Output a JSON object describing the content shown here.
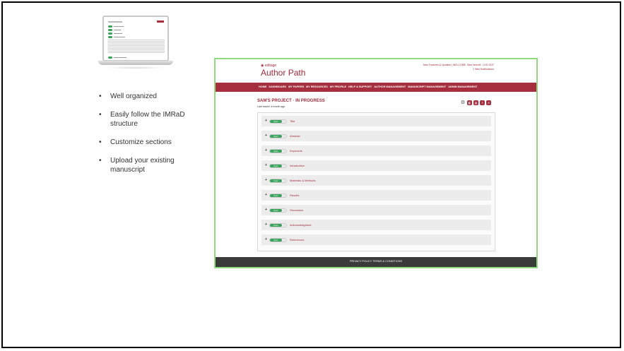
{
  "bullets": [
    "Well organized",
    "Easily follow the IMRaD structure",
    "Customize sections",
    "Upload your existing manuscript"
  ],
  "bullet_glyph": "•",
  "app": {
    "brand_small": "◉ editage",
    "brand_main": "Author Path",
    "user_links_line1": "New Features & Updates | WELCOME, Sam Worrell · LOG OUT",
    "user_links_line2": "1 New Notifications",
    "nav": [
      "HOME",
      "DASHBOARD",
      "MY PAPERS",
      "MY RESOURCES",
      "MY PROFILE",
      "HELP & SUPPORT",
      "AUTHOR MANAGEMENT",
      "MANUSCRIPT MANAGEMENT",
      "ADMIN MANAGEMENT"
    ],
    "project_title": "SAM'S PROJECT  ·  IN PROGRESS",
    "last_saved": "Last saved: a month ago",
    "toolbar_icons": [
      "gear-icon",
      "view-icon",
      "export-icon",
      "share-icon",
      "delete-icon"
    ],
    "toggle_label": "Open",
    "sections": [
      "Title",
      "Abstract",
      "Keywords",
      "Introduction",
      "Materials & Methods",
      "Results",
      "Discussion",
      "Acknowledgment",
      "References"
    ],
    "footer": "PRIVACY POLICY   TERMS & CONDITIONS",
    "colors": {
      "brand": "#a52f3f",
      "toggle_on": "#3aa35b",
      "footer": "#3a3a3a"
    }
  }
}
